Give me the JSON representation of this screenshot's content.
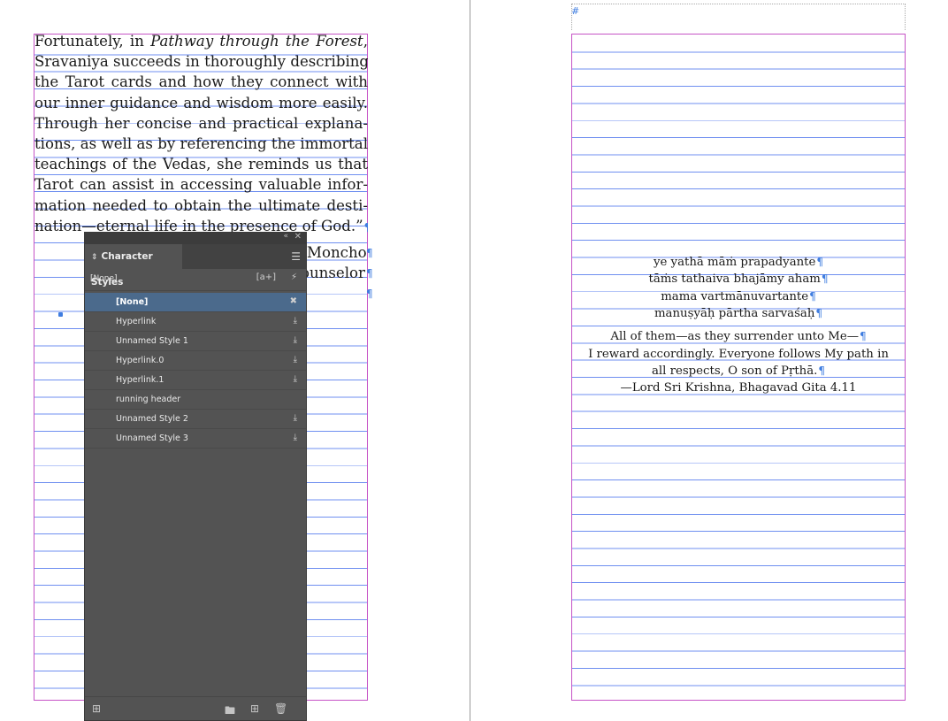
{
  "spread": {
    "body_lines": [
      {
        "pre": "Fortunately, in ",
        "em": "Pathway through the Forest",
        "post": ","
      },
      {
        "text": "Sravaniya succeeds in thoroughly describing"
      },
      {
        "text": "the Tarot cards and how they connect with"
      },
      {
        "text": "our inner guidance and wisdom more easily."
      },
      {
        "text": "Through her concise and practical explana-"
      },
      {
        "text": "tions, as well as by referencing the immortal"
      },
      {
        "text": "teachings of the Vedas, she reminds us that"
      },
      {
        "text": "Tarot can assist in accessing valuable infor-"
      },
      {
        "text": "mation needed to obtain the ultimate desti-"
      },
      {
        "text": "nation—eternal life in the presence of God.”"
      }
    ],
    "behind_panel_1": "Moncho",
    "behind_panel_2": "ounselor",
    "pilcrow": "¶",
    "verse_lines": [
      "ye yathā māṁ prapadyante",
      "tāṁs tathaiva bhajāmy aham",
      "mama vartmānuvartante",
      "manuṣyāḥ pārtha sarvaśaḥ"
    ],
    "translation_lines": [
      "All of them—as they surrender unto Me—",
      "I reward accordingly. Everyone follows My path in",
      "all respects, O son of Pṛthā.",
      "—Lord Sri Krishna, Bhagavad Gita 4.11"
    ],
    "end_mark": "#"
  },
  "panel": {
    "title": "Character Styles",
    "current_style": "[None]",
    "styles": [
      {
        "name": "[None]",
        "selected": true,
        "icon": "locked-icon"
      },
      {
        "name": "Hyperlink",
        "icon": "import-icon"
      },
      {
        "name": "Unnamed Style 1",
        "icon": "import-icon"
      },
      {
        "name": "Hyperlink.0",
        "icon": "import-icon"
      },
      {
        "name": "Hyperlink.1",
        "icon": "import-icon"
      },
      {
        "name": "running header",
        "icon": ""
      },
      {
        "name": "Unnamed Style 2",
        "icon": "import-icon"
      },
      {
        "name": "Unnamed Style 3",
        "icon": "import-icon"
      }
    ]
  },
  "colors": {
    "panel_bg": "#535353",
    "selected_row": "#4b6a8c",
    "guide_line": "#6f8ff0",
    "margin_frame": "#c653c6",
    "pilcrow": "#3f7de0"
  }
}
